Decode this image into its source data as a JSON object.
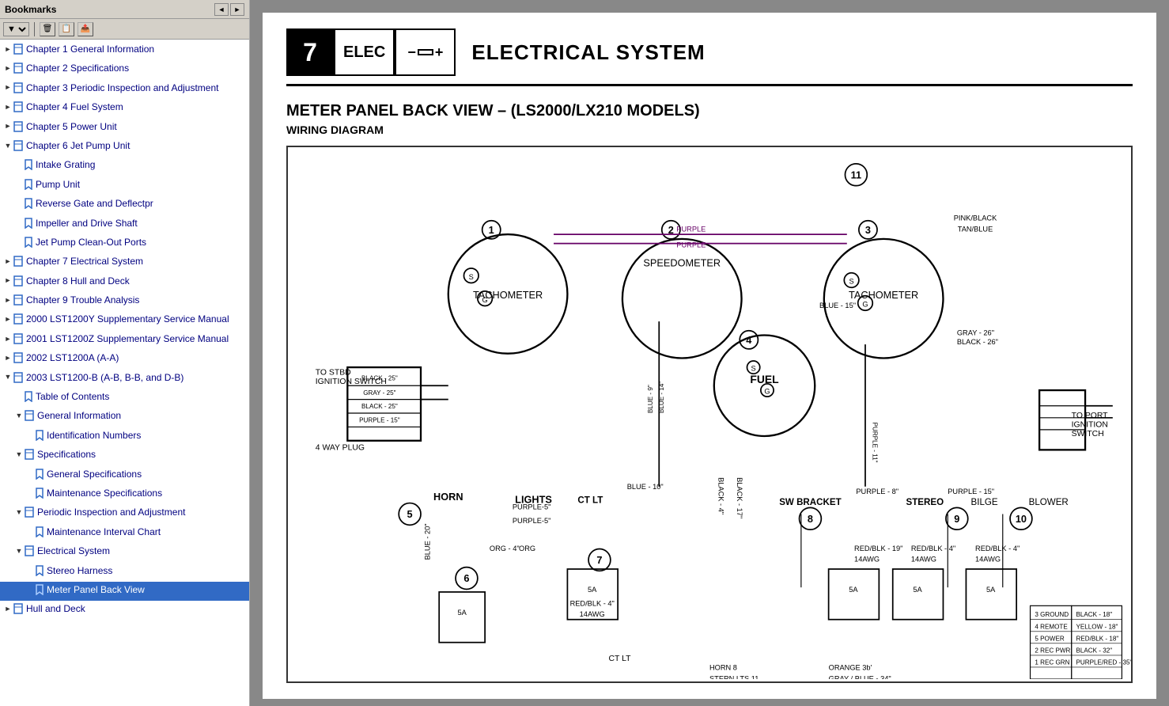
{
  "sidebar": {
    "header": "Bookmarks",
    "nav_buttons": [
      "◄",
      "►"
    ],
    "toolbar_buttons": [
      {
        "label": "🗑",
        "name": "delete-bookmark"
      },
      {
        "label": "📋",
        "name": "copy-bookmark"
      },
      {
        "label": "📤",
        "name": "export-bookmark"
      }
    ],
    "dropdown_label": "▼",
    "items": [
      {
        "id": "ch1",
        "label": "Chapter 1 General Information",
        "level": 0,
        "expanded": false,
        "has_children": true
      },
      {
        "id": "ch2",
        "label": "Chapter 2 Specifications",
        "level": 0,
        "expanded": false,
        "has_children": true
      },
      {
        "id": "ch3",
        "label": "Chapter 3 Periodic Inspection and Adjustment",
        "level": 0,
        "expanded": false,
        "has_children": true
      },
      {
        "id": "ch4",
        "label": "Chapter 4 Fuel System",
        "level": 0,
        "expanded": false,
        "has_children": true
      },
      {
        "id": "ch5",
        "label": "Chapter 5 Power Unit",
        "level": 0,
        "expanded": false,
        "has_children": true
      },
      {
        "id": "ch6",
        "label": "Chapter 6 Jet Pump Unit",
        "level": 0,
        "expanded": true,
        "has_children": true
      },
      {
        "id": "ch6-1",
        "label": "Intake Grating",
        "level": 1,
        "expanded": false,
        "has_children": false
      },
      {
        "id": "ch6-2",
        "label": "Pump Unit",
        "level": 1,
        "expanded": false,
        "has_children": false
      },
      {
        "id": "ch6-3",
        "label": "Reverse Gate and Deflectpr",
        "level": 1,
        "expanded": false,
        "has_children": false
      },
      {
        "id": "ch6-4",
        "label": "Impeller and Drive Shaft",
        "level": 1,
        "expanded": false,
        "has_children": false
      },
      {
        "id": "ch6-5",
        "label": "Jet Pump Clean-Out Ports",
        "level": 1,
        "expanded": false,
        "has_children": false
      },
      {
        "id": "ch7",
        "label": "Chapter 7 Electrical System",
        "level": 0,
        "expanded": false,
        "has_children": true
      },
      {
        "id": "ch8",
        "label": "Chapter 8 Hull and Deck",
        "level": 0,
        "expanded": false,
        "has_children": true
      },
      {
        "id": "ch9",
        "label": "Chapter 9 Trouble Analysis",
        "level": 0,
        "expanded": false,
        "has_children": true
      },
      {
        "id": "ch10",
        "label": "2000 LST1200Y Supplementary Service Manual",
        "level": 0,
        "expanded": false,
        "has_children": true
      },
      {
        "id": "ch11",
        "label": "2001 LST1200Z Supplementary Service Manual",
        "level": 0,
        "expanded": false,
        "has_children": true
      },
      {
        "id": "ch12",
        "label": "2002 LST1200A (A-A)",
        "level": 0,
        "expanded": false,
        "has_children": true
      },
      {
        "id": "ch13",
        "label": "2003 LST1200-B (A-B, B-B, and D-B)",
        "level": 0,
        "expanded": true,
        "has_children": true
      },
      {
        "id": "ch13-toc",
        "label": "Table of Contents",
        "level": 1,
        "expanded": false,
        "has_children": false
      },
      {
        "id": "ch13-gi",
        "label": "General Information",
        "level": 1,
        "expanded": true,
        "has_children": true
      },
      {
        "id": "ch13-gi-1",
        "label": "Identification Numbers",
        "level": 2,
        "expanded": false,
        "has_children": false
      },
      {
        "id": "ch13-spec",
        "label": "Specifications",
        "level": 1,
        "expanded": true,
        "has_children": true
      },
      {
        "id": "ch13-spec-1",
        "label": "General Specifications",
        "level": 2,
        "expanded": false,
        "has_children": false
      },
      {
        "id": "ch13-spec-2",
        "label": "Maintenance Specifications",
        "level": 2,
        "expanded": false,
        "has_children": false
      },
      {
        "id": "ch13-pia",
        "label": "Periodic Inspection and Adjustment",
        "level": 1,
        "expanded": true,
        "has_children": true
      },
      {
        "id": "ch13-pia-1",
        "label": "Maintenance Interval Chart",
        "level": 2,
        "expanded": false,
        "has_children": false
      },
      {
        "id": "ch13-elec",
        "label": "Electrical System",
        "level": 1,
        "expanded": true,
        "has_children": true
      },
      {
        "id": "ch13-elec-1",
        "label": "Stereo Harness",
        "level": 2,
        "expanded": false,
        "has_children": false
      },
      {
        "id": "ch13-elec-2",
        "label": "Meter Panel Back View",
        "level": 2,
        "expanded": false,
        "has_children": false,
        "selected": true
      },
      {
        "id": "ch14",
        "label": "Hull and Deck",
        "level": 0,
        "expanded": false,
        "has_children": true
      }
    ]
  },
  "content": {
    "chapter_num": "7",
    "chapter_code": "ELEC",
    "chapter_full_title": "ELECTRICAL SYSTEM",
    "section_title": "METER PANEL BACK VIEW – (LS2000/LX210 MODELS)",
    "section_subtitle": "WIRING DIAGRAM"
  }
}
